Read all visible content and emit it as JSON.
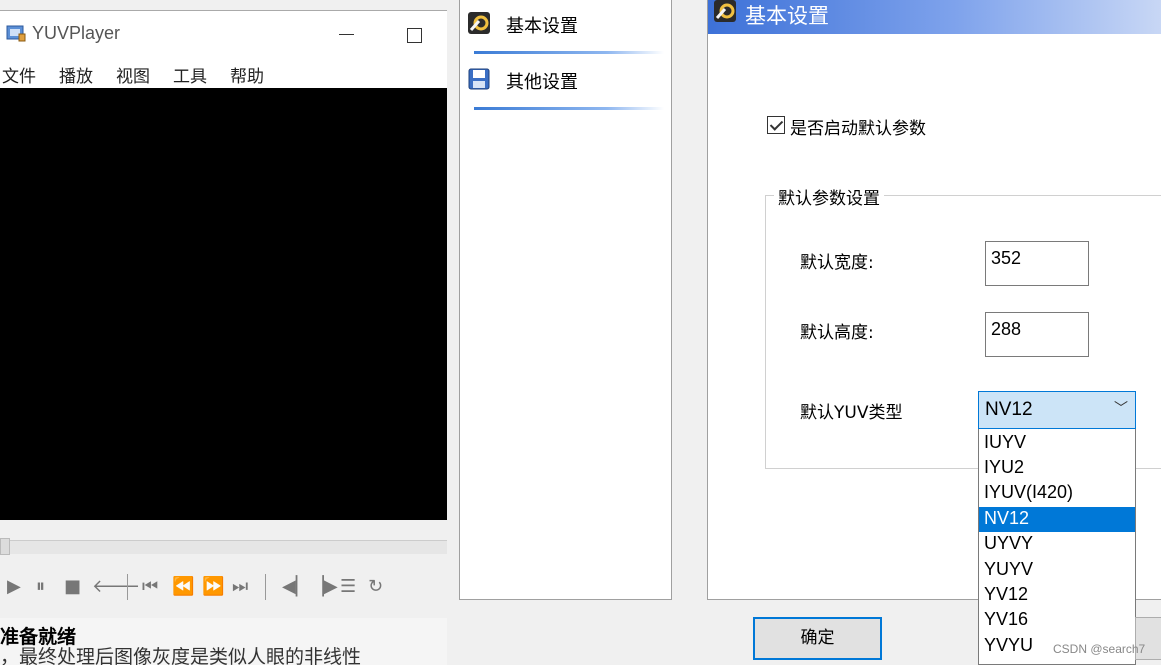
{
  "player": {
    "title": "YUVPlayer",
    "menu": [
      "文件",
      "播放",
      "视图",
      "工具",
      "帮助"
    ],
    "seek_progress": 0,
    "status": "准备就绪",
    "status_overlap_text": "，最终处理后图像灰度是类似人眼的非线性"
  },
  "dialog": {
    "nav": {
      "items": [
        {
          "label": "基本设置",
          "icon": "gear-tools-icon"
        },
        {
          "label": "其他设置",
          "icon": "floppy-disk-icon"
        }
      ]
    },
    "header": {
      "title": "基本设置",
      "icon": "gear-tools-icon"
    },
    "enable_default": {
      "label": "是否启动默认参数",
      "checked": true
    },
    "group": {
      "title": "默认参数设置",
      "width_label": "默认宽度:",
      "width_value": "352",
      "height_label": "默认高度:",
      "height_value": "288",
      "yuv_label": "默认YUV类型",
      "yuv_selected": "NV12",
      "yuv_options": [
        "IUYV",
        "IYU2",
        "IYUV(I420)",
        "NV12",
        "UYVY",
        "YUYV",
        "YV12",
        "YV16",
        "YVYU"
      ]
    },
    "ok_label": "确定"
  },
  "watermark": "CSDN @search7",
  "colors": {
    "accent": "#0078d7",
    "header_gradient_start": "#3d71d8",
    "video_bg": "#000000"
  }
}
